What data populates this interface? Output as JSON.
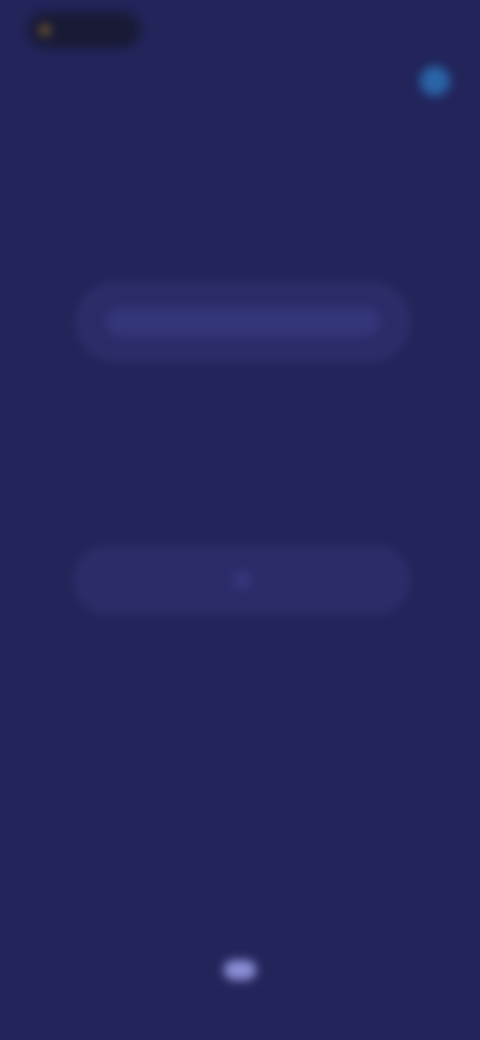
{
  "status_bar": {
    "left_text": "",
    "right_text": ""
  },
  "header": {
    "title": ""
  },
  "card_1": {
    "label": ""
  },
  "text_1": "",
  "segments": [
    {
      "label": "",
      "active": false
    },
    {
      "label": "",
      "active": true
    },
    {
      "label": "",
      "active": false
    }
  ],
  "text_2": "",
  "footer": {
    "link_label": ""
  },
  "nav": [
    {
      "label": "",
      "active": false
    },
    {
      "label": "",
      "active": false
    },
    {
      "label": "",
      "active": true
    },
    {
      "label": "",
      "active": false
    },
    {
      "label": "",
      "active": false
    }
  ],
  "colors": {
    "background": "#22245a",
    "card": "#2a2c68",
    "accent": "#2a64a8",
    "nav_active": "#8d8fd8"
  },
  "icons": {
    "status": "status-dot-icon",
    "avatar": "avatar-icon"
  }
}
